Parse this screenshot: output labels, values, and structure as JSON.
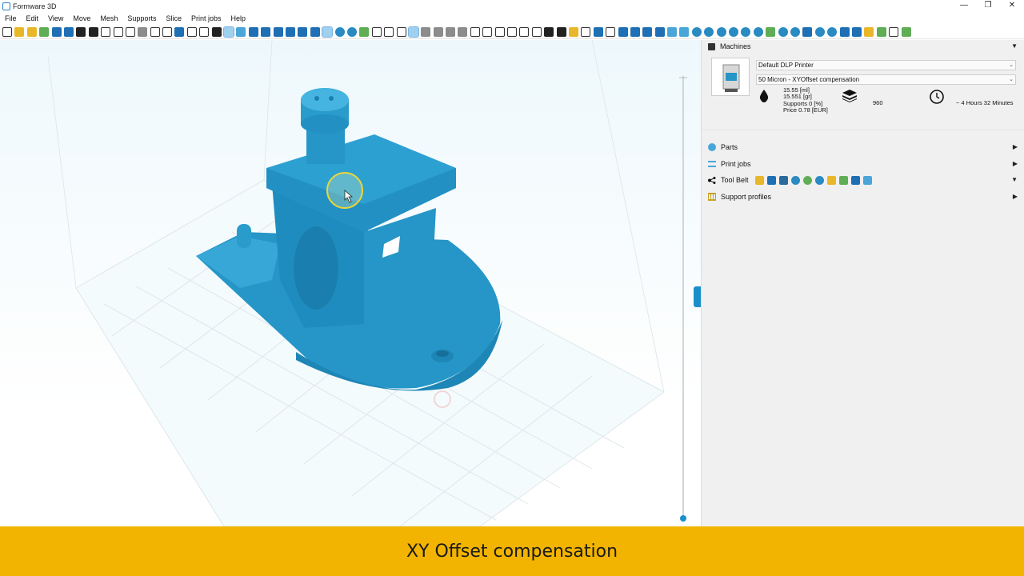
{
  "window": {
    "title": "Formware 3D",
    "controls": [
      "—",
      "❐",
      "✕"
    ]
  },
  "menu": [
    "File",
    "Edit",
    "View",
    "Move",
    "Mesh",
    "Supports",
    "Slice",
    "Print jobs",
    "Help"
  ],
  "side_panel": {
    "machines": {
      "header": "Machines",
      "printer": "Default DLP Printer",
      "profile": "50 Micron - XYOffset compensation",
      "stats": {
        "volume_ml": "15.55 [ml]",
        "weight_gr": "15.551 [gr]",
        "supports": "Supports 0 [%]",
        "price": "Price 0.78 [EUR]",
        "layers": "960",
        "time": "~ 4 Hours 32 Minutes"
      }
    },
    "sections": {
      "parts": "Parts",
      "print_jobs": "Print jobs",
      "tool_belt": "Tool Belt",
      "support_profiles": "Support profiles"
    }
  },
  "caption": "XY Offset compensation",
  "colors": {
    "model": "#2596c7",
    "caption_bg": "#f2b400",
    "accent": "#1c8ecb"
  }
}
